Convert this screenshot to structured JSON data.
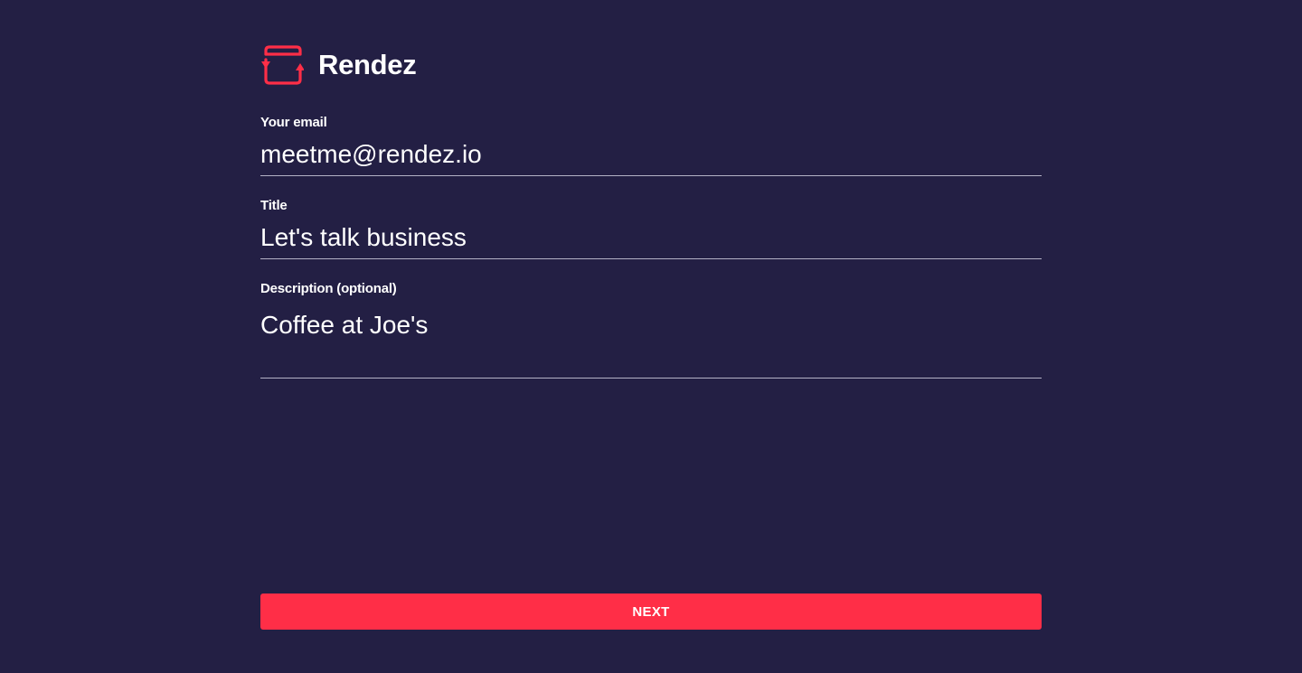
{
  "brand": {
    "name": "Rendez",
    "logo_icon": "calendar-sync-icon",
    "accent_color": "#ff2e47"
  },
  "form": {
    "email": {
      "label": "Your email",
      "value": "meetme@rendez.io"
    },
    "title": {
      "label": "Title",
      "value": "Let's talk business"
    },
    "description": {
      "label": "Description (optional)",
      "value": "Coffee at Joe's"
    },
    "next_label": "NEXT"
  },
  "colors": {
    "background": "#231f44",
    "text": "#ffffff",
    "underline": "#b4b2c6"
  }
}
